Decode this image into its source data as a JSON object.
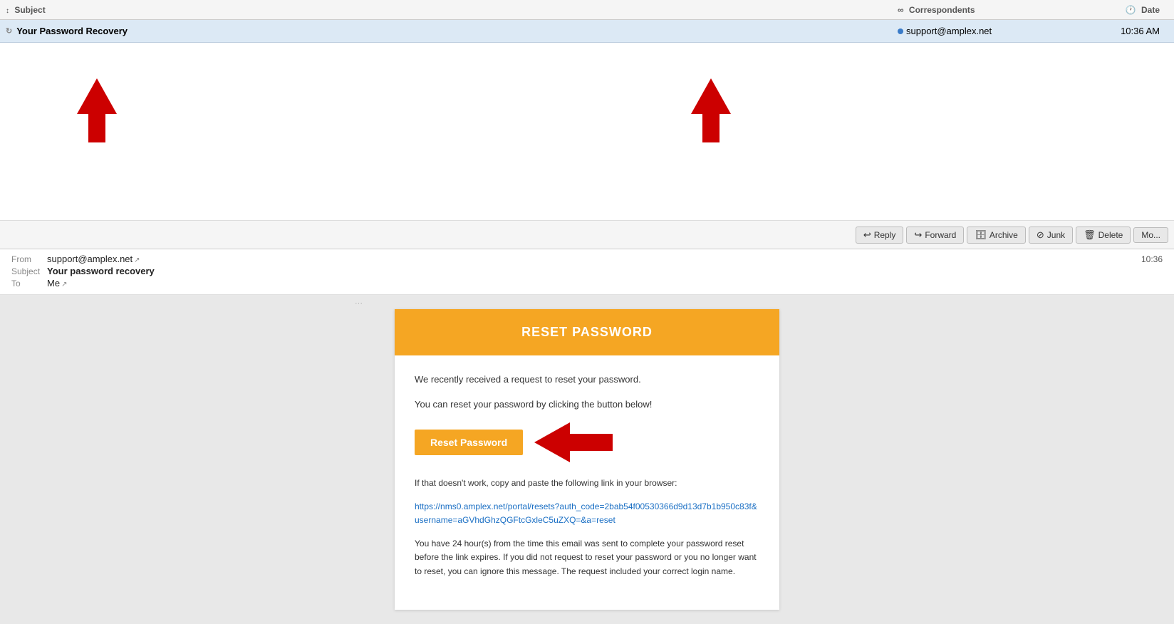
{
  "header": {
    "col_subject": "Subject",
    "col_correspondents": "Correspondents",
    "col_date": "Date",
    "subject_icon": "🔁",
    "correspondents_icon": "∞",
    "date_icon": "🕐"
  },
  "email_row": {
    "subject": "Your Password Recovery",
    "correspondent": "support@amplex.net",
    "time": "10:36 AM"
  },
  "toolbar": {
    "reply_label": "Reply",
    "forward_label": "Forward",
    "archive_label": "Archive",
    "junk_label": "Junk",
    "delete_label": "Delete",
    "more_label": "Mo..."
  },
  "email_meta": {
    "from_label": "From",
    "from_value": "support@amplex.net",
    "subject_label": "Subject",
    "subject_value": "Your password recovery",
    "to_label": "To",
    "to_value": "Me",
    "time": "10:36"
  },
  "email_body": {
    "header_title": "RESET PASSWORD",
    "paragraph1": "We recently received a request to reset your password.",
    "paragraph2": "You can reset your password by clicking the button below!",
    "reset_button_label": "Reset Password",
    "link_note": "If that doesn't work, copy and paste the following link in your browser:",
    "reset_link": "https://nms0.amplex.net/portal/resets?auth_code=2bab54f00530366d9d13d7b1b950c83f&username=aGVhdGhzQGFtcGxleC5uZXQ=&a=reset",
    "expiry_note": "You have 24 hour(s) from the time this email was sent to complete your password reset before the link expires. If you did not request to reset your password or you no longer want to reset, you can ignore this message. The request included your correct login name."
  }
}
